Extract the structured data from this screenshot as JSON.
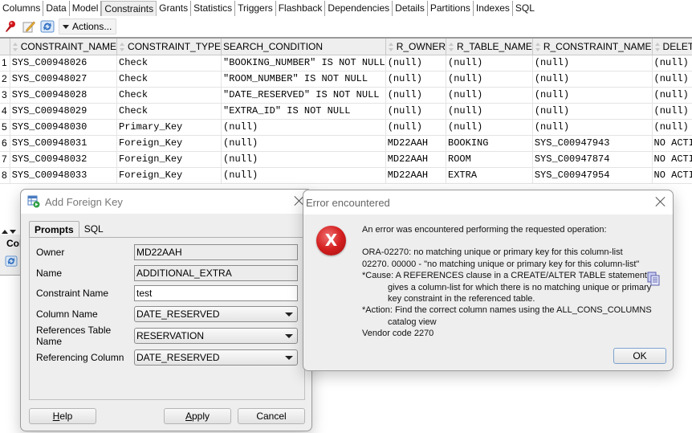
{
  "tabs": [
    {
      "label": "Columns",
      "active": false
    },
    {
      "label": "Data",
      "active": false
    },
    {
      "label": "Model",
      "active": false
    },
    {
      "label": "Constraints",
      "active": true
    },
    {
      "label": "Grants",
      "active": false
    },
    {
      "label": "Statistics",
      "active": false
    },
    {
      "label": "Triggers",
      "active": false
    },
    {
      "label": "Flashback",
      "active": false
    },
    {
      "label": "Dependencies",
      "active": false
    },
    {
      "label": "Details",
      "active": false
    },
    {
      "label": "Partitions",
      "active": false
    },
    {
      "label": "Indexes",
      "active": false
    },
    {
      "label": "SQL",
      "active": false
    }
  ],
  "toolbar": {
    "icons": [
      "pin-icon",
      "edit-icon",
      "refresh-icon"
    ],
    "actions_label": "Actions..."
  },
  "grid": {
    "columns": [
      "CONSTRAINT_NAME",
      "CONSTRAINT_TYPE",
      "SEARCH_CONDITION",
      "R_OWNER",
      "R_TABLE_NAME",
      "R_CONSTRAINT_NAME",
      "DELETE_RULE"
    ],
    "rows": [
      {
        "n": "1",
        "cells": [
          "SYS_C00948026",
          "Check",
          "\"BOOKING_NUMBER\" IS NOT NULL",
          "(null)",
          "(null)",
          "(null)",
          "(null)"
        ]
      },
      {
        "n": "2",
        "cells": [
          "SYS_C00948027",
          "Check",
          "\"ROOM_NUMBER\" IS NOT NULL",
          "(null)",
          "(null)",
          "(null)",
          "(null)"
        ]
      },
      {
        "n": "3",
        "cells": [
          "SYS_C00948028",
          "Check",
          "\"DATE_RESERVED\" IS NOT NULL",
          "(null)",
          "(null)",
          "(null)",
          "(null)"
        ]
      },
      {
        "n": "4",
        "cells": [
          "SYS_C00948029",
          "Check",
          "\"EXTRA_ID\" IS NOT NULL",
          "(null)",
          "(null)",
          "(null)",
          "(null)"
        ]
      },
      {
        "n": "5",
        "cells": [
          "SYS_C00948030",
          "Primary_Key",
          "(null)",
          "(null)",
          "(null)",
          "(null)",
          "(null)"
        ]
      },
      {
        "n": "6",
        "cells": [
          "SYS_C00948031",
          "Foreign_Key",
          "(null)",
          "MD22AAH",
          "BOOKING",
          "SYS_C00947943",
          "NO ACTION"
        ]
      },
      {
        "n": "7",
        "cells": [
          "SYS_C00948032",
          "Foreign_Key",
          "(null)",
          "MD22AAH",
          "ROOM",
          "SYS_C00947874",
          "NO ACTION"
        ]
      },
      {
        "n": "8",
        "cells": [
          "SYS_C00948033",
          "Foreign_Key",
          "(null)",
          "MD22AAH",
          "EXTRA",
          "SYS_C00947954",
          "NO ACTION"
        ]
      }
    ]
  },
  "lower_panel": {
    "title": "Col"
  },
  "fk_dialog": {
    "title": "Add Foreign Key",
    "tabs": [
      "Prompts",
      "SQL"
    ],
    "fields": [
      {
        "label": "Owner",
        "value": "MD22AAH",
        "kind": "readonly"
      },
      {
        "label": "Name",
        "value": "ADDITIONAL_EXTRA",
        "kind": "readonly"
      },
      {
        "label": "Constraint Name",
        "value": "test",
        "kind": "input"
      },
      {
        "label": "Column Name",
        "value": "DATE_RESERVED",
        "kind": "select"
      },
      {
        "label": "References Table Name",
        "value": "RESERVATION",
        "kind": "select"
      },
      {
        "label": "Referencing Column",
        "value": "DATE_RESERVED",
        "kind": "select"
      }
    ],
    "buttons": {
      "help": {
        "mnemonic": "H",
        "rest": "elp"
      },
      "apply": {
        "mnemonic": "A",
        "rest": "pply"
      },
      "cancel": "Cancel"
    }
  },
  "error_dialog": {
    "title": "Error encountered",
    "icon_glyph": "X",
    "heading": "An error was encountered performing the requested operation:",
    "lines": [
      "ORA-02270: no matching unique or primary key for this column-list",
      "02270. 00000 -  \"no matching unique or primary key for this column-list\"",
      "*Cause:    A REFERENCES clause in a CREATE/ALTER TABLE statement",
      "gives a column-list for which there is no matching unique or primary",
      "key constraint in the referenced table.",
      "*Action:   Find the correct column names using the ALL_CONS_COLUMNS",
      "catalog view",
      "Vendor code 2270"
    ],
    "ok_label": "OK"
  }
}
